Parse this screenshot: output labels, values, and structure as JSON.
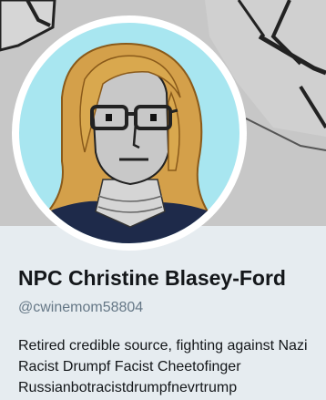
{
  "profile": {
    "display_name": "NPC Christine Blasey-Ford",
    "handle": "@cwinemom58804",
    "bio": "Retired credible source, fighting against Nazi Racist Drumpf Facist Cheetofinger Russianbotracistdrumpfnevrtrump"
  },
  "banner": {
    "icon": "npc-meme-banner-image"
  },
  "avatar": {
    "icon": "npc-avatar-image",
    "background": "#a8e6f0"
  },
  "colors": {
    "name": "#14171a",
    "handle": "#657786",
    "page_bg": "#e6ecf0"
  }
}
